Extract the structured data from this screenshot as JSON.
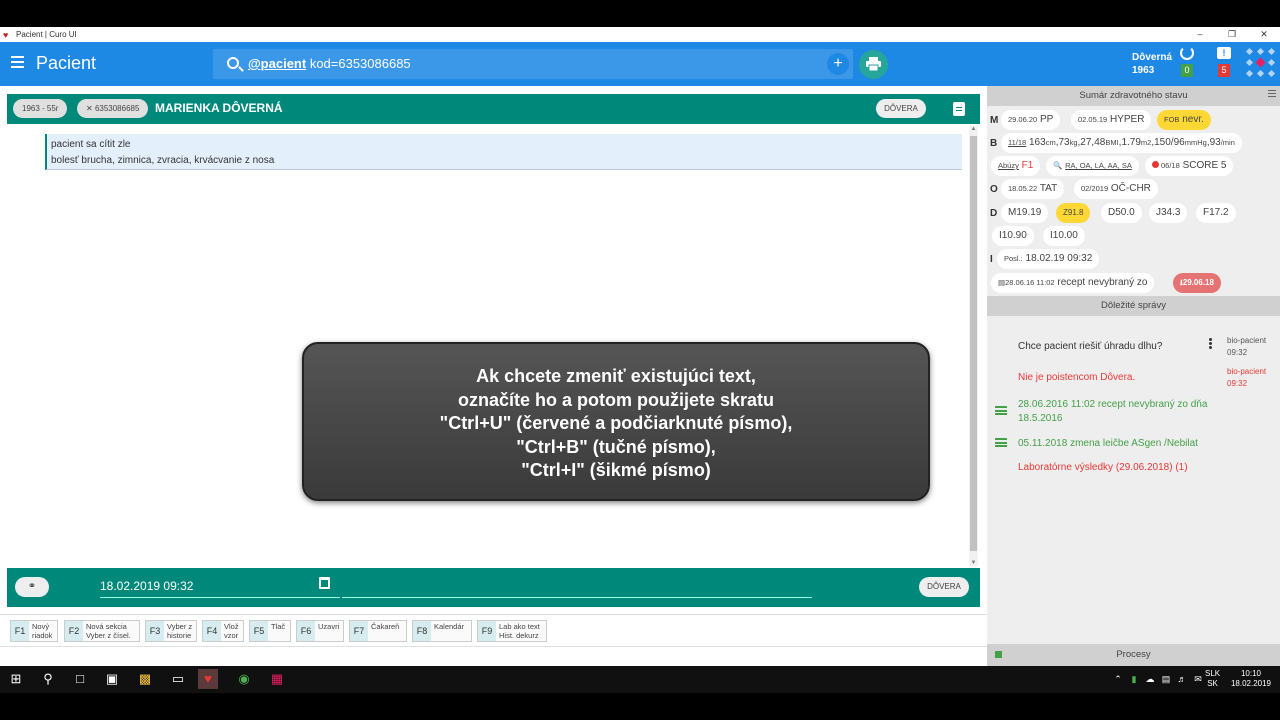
{
  "window": {
    "title": "Pacient | Curo UI",
    "controls": [
      "–",
      "❐",
      "✕"
    ]
  },
  "appbar": {
    "title": "Pacient",
    "search_prefix": "@pacient",
    "search_query": " kod=6353086685",
    "search_add": "+",
    "user_name": "Dôverná",
    "user_year": "1963",
    "sync_count": "0",
    "message_count": "5",
    "accent": "#1e88e5"
  },
  "patient": {
    "age_chip": "1963 - 55r",
    "code_chip": "6353086685",
    "name": "MARIENKA DÔVERNÁ",
    "insurer": "DÔVERA",
    "bar_color": "#00897b"
  },
  "note": {
    "line1": "pacient sa cítit zle",
    "line2": "bolesť brucha, zimnica, zvracia, krvácvanie z nosa"
  },
  "overlay": {
    "line1": "Ak chcete zmeniť existujúci text,",
    "line2": "označíte ho a potom použijete skratu",
    "line3": "\"Ctrl+U\" (červené a podčiarknuté písmo),",
    "line4": "\"Ctrl+B\" (tučné písmo),",
    "line5": "\"Ctrl+I\" (šikmé písmo)"
  },
  "bottom": {
    "datetime": "18.02.2019 09:32",
    "insurer": "DÔVERA"
  },
  "fkeys": [
    {
      "key": "F1",
      "l1": "Nový",
      "l2": "riadok"
    },
    {
      "key": "F2",
      "l1": "Nová sekcia",
      "l2": "Vyber z čísel."
    },
    {
      "key": "F3",
      "l1": "Vyber z",
      "l2": "historie"
    },
    {
      "key": "F4",
      "l1": "Vlož",
      "l2": "vzor"
    },
    {
      "key": "F5",
      "l1": "Tlač",
      "l2": ""
    },
    {
      "key": "F6",
      "l1": "Uzavri",
      "l2": ""
    },
    {
      "key": "F7",
      "l1": "Čakareň",
      "l2": ""
    },
    {
      "key": "F8",
      "l1": "Kalendár",
      "l2": ""
    },
    {
      "key": "F9",
      "l1": "Lab ako text",
      "l2": "Hist. dekurz"
    }
  ],
  "summary": {
    "header": "Sumár zdravotného stavu",
    "letters": [
      "M",
      "B",
      "O",
      "D",
      "I"
    ],
    "m": [
      "29.06.20",
      "PP",
      "02.05.19",
      "HYPER",
      "FOB",
      "nevr."
    ],
    "b": {
      "date": "11/18",
      "v1": "163",
      "u1": "cm",
      "v2": ",73",
      "u2": "kg",
      "v3": ",27,48",
      "u3": "BMI",
      "v4": ",1.79",
      "u4": "m2",
      "v5": ",150/96",
      "u5": "mmHg",
      "v6": ",93",
      "u6": "/min"
    },
    "abuzy": "Abúzy",
    "abuzy_val": "F1",
    "allergy": "RA, OA, LA, AA, SA",
    "score_date": "06/18",
    "score": "SCORE 5",
    "o": [
      "18.05.22",
      "TAT",
      "02/2019",
      "OČ-CHR"
    ],
    "d": [
      "M19.19",
      "Z91.8",
      "D50.0",
      "J34.3",
      "F17.2",
      "I10.90",
      "I10.00"
    ],
    "i_label": "Posl.:",
    "i_value": "18.02.19 09:32",
    "recept_date": "28.06.16 11:02",
    "recept_text": "recept nevybraný zo",
    "recept_red": "29.06.18"
  },
  "messages": {
    "header": "Dôležité správy",
    "items": [
      {
        "text": "Chce pacient riešiť úhradu dlhu?",
        "src": "bio-pacient",
        "time": "09:32"
      },
      {
        "text": "Nie je poistencom Dôvera.",
        "src": "bio-pacient",
        "time": "09:32"
      },
      {
        "text1": "28.06.2016 11:02 recept nevybraný zo dňa",
        "text2": "18.5.2016"
      },
      {
        "text": "05.11.2018 zmena leičbe ASgen /Nebilat"
      },
      {
        "text": "Laboratórne výsledky (29.06.2018) (1)"
      }
    ]
  },
  "processes": {
    "label": "Procesy"
  },
  "taskbar": {
    "lang1": "SLK",
    "lang2": "SK",
    "time": "10:10",
    "date": "18.02.2019"
  }
}
